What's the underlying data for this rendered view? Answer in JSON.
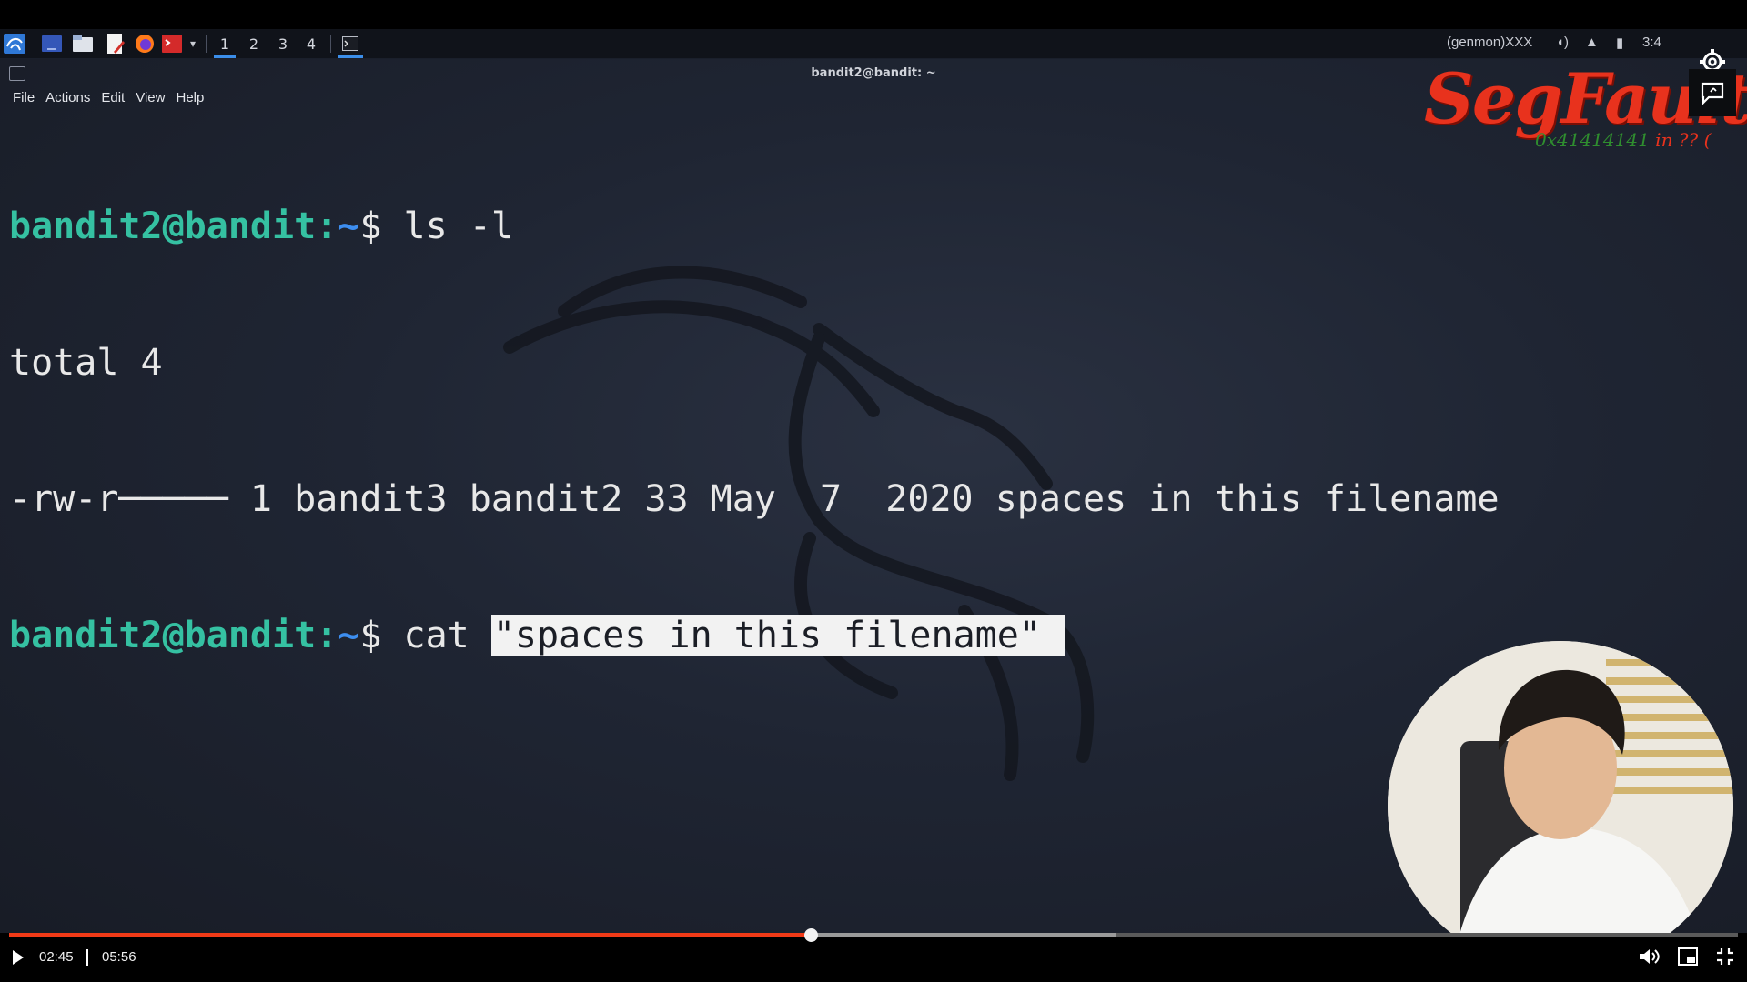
{
  "taskbar": {
    "workspaces": [
      "1",
      "2",
      "3",
      "4"
    ],
    "active_workspace": "1",
    "tray_text": "(genmon)XXX",
    "clock": "3:4"
  },
  "window": {
    "title": "bandit2@bandit: ~",
    "menu": [
      "File",
      "Actions",
      "Edit",
      "View",
      "Help"
    ]
  },
  "terminal": {
    "prompt_user": "bandit2@bandit:",
    "prompt_path": "~",
    "prompt_symbol": "$",
    "line1_cmd": " ls -l",
    "line2": "total 4",
    "line3": "-rw-r───── 1 bandit3 bandit2 33 May  7  2020 spaces in this filename",
    "line4_cmd": " cat ",
    "line4_selected": "\"spaces in this filename\""
  },
  "logo": {
    "title": "SegFault",
    "subtitle": "0x41414141",
    "subtitle_suffix": " in ?? ("
  },
  "player": {
    "current_time": "02:45",
    "duration": "05:56",
    "progress_fraction": 0.4635,
    "buffer_fraction": 0.64
  },
  "colors": {
    "progress": "#f03a17",
    "prompt_user": "#35c1a2",
    "prompt_path": "#3d8ef0",
    "logo": "#e8321d"
  }
}
